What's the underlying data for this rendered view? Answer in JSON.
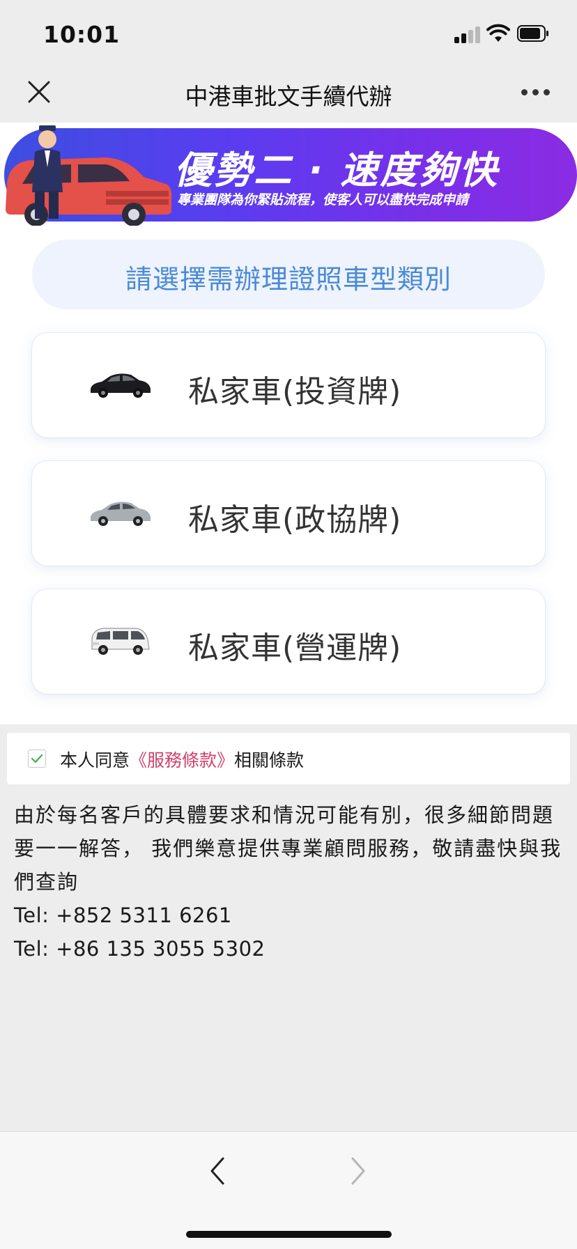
{
  "status_bar": {
    "time": "10:01"
  },
  "nav": {
    "title": "中港車批文手續代辦"
  },
  "banner": {
    "headline": "優勢二 · 速度夠快",
    "subtitle": "專業團隊為你緊貼流程，使客人可以盡快完成申請"
  },
  "section_header": "請選擇需辦理證照車型類別",
  "options": [
    {
      "label": "私家車(投資牌)",
      "car_color": "#1c1c1e",
      "icon": "black-sedan-icon"
    },
    {
      "label": "私家車(政協牌)",
      "car_color": "#a9adb4",
      "icon": "silver-sedan-icon"
    },
    {
      "label": "私家車(營運牌)",
      "car_color": "#f1f1f1",
      "icon": "white-mpv-icon"
    }
  ],
  "agreement": {
    "prefix": "本人同意",
    "link": "《服務條款》",
    "suffix": "相關條款",
    "checked": true
  },
  "info": {
    "paragraph": "由於每名客戶的具體要求和情況可能有別，很多細節問題要一一解答， 我們樂意提供專業顧問服務，敬請盡快與我們查詢",
    "tel1": "Tel: +852 5311 6261",
    "tel2": "Tel: +86 135 3055 5302"
  },
  "colors": {
    "accent_blue": "#4a8ad6",
    "link_pink": "#d0416d",
    "banner_start": "#3d4ee0",
    "banner_end": "#8b2ce3",
    "check_green": "#3bb44a"
  }
}
